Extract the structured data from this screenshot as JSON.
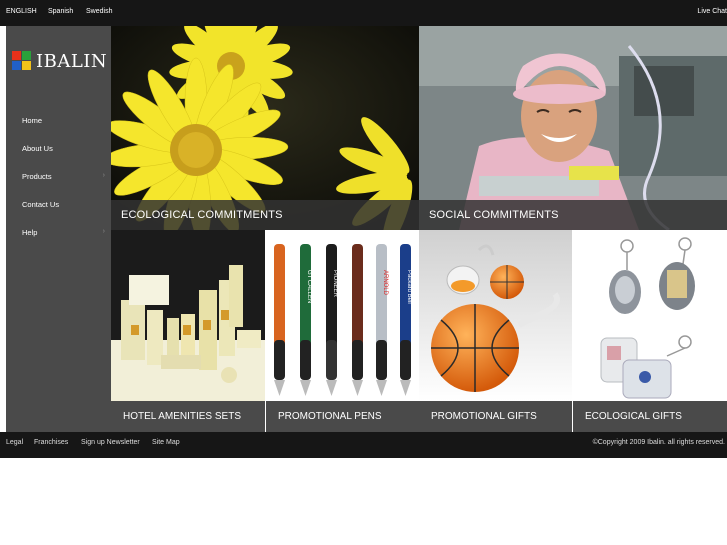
{
  "topbar": {
    "languages": [
      "ENGLISH",
      "Spanish",
      "Swedish"
    ],
    "live_chat": "Live Chat"
  },
  "brand": {
    "logo_text": "IBALIN",
    "logo_colors": [
      "#e8311a",
      "#2aa13b",
      "#2060c8",
      "#f2c21a"
    ]
  },
  "nav": {
    "items": [
      {
        "label": "Home",
        "has_submenu": false
      },
      {
        "label": "About Us",
        "has_submenu": false
      },
      {
        "label": "Products",
        "has_submenu": true
      },
      {
        "label": "Contact Us",
        "has_submenu": false
      },
      {
        "label": "Help",
        "has_submenu": true
      }
    ]
  },
  "hero": {
    "ecological": "ECOLOGICAL COMMITMENTS",
    "social": "SOCIAL COMMITMENTS"
  },
  "products": {
    "hotel": "HOTEL AMENITIES SETS",
    "pens": "PROMOTIONAL PENS",
    "gifts": "PROMOTIONAL GIFTS",
    "eco_gifts": "ECOLOGICAL GIFTS",
    "pen_brands": [
      "GT CALLEN",
      "PIONEER",
      "ARNOLD",
      "Packard Bell"
    ]
  },
  "footer": {
    "links": [
      "Legal",
      "Franchises",
      "Sign up Newsletter",
      "Site Map"
    ],
    "copyright": "©Copyright 2009 Ibalin. all rights reserved."
  }
}
